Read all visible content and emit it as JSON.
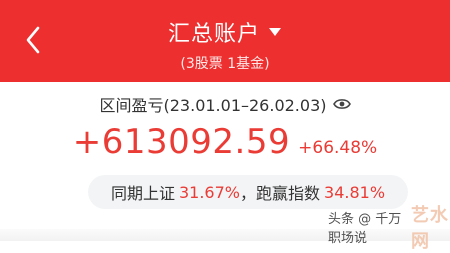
{
  "header": {
    "title": "汇总账户",
    "subtitle": "(3股票 1基金)"
  },
  "summary": {
    "range_label": "区间盈亏(23.01.01–26.02.03)",
    "profit_value": "+613092.59",
    "profit_pct": "+66.48%"
  },
  "compare": {
    "prefix": "同期上证",
    "sse_pct": "31.67%",
    "middle": "，跑赢指数",
    "beat_pct": "34.81%"
  },
  "watermark": {
    "text": "头条 @ 千万职场说",
    "logo": "艺水网"
  },
  "colors": {
    "header_bg": "#ee2f2f",
    "profit_red": "#ea3b35",
    "pill_bg": "#f3f4f6"
  },
  "icons": {
    "back": "chevron-left-icon",
    "dropdown": "caret-down-icon",
    "visibility": "eye-icon"
  }
}
